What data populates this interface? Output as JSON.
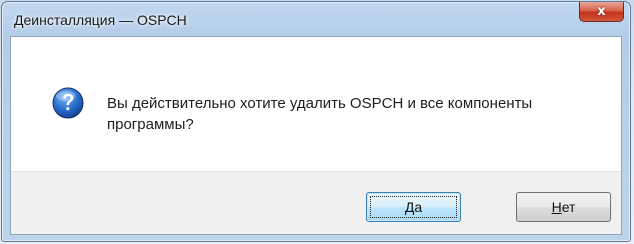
{
  "dialog": {
    "title": "Деинсталляция — OSPCH",
    "close_glyph": "x",
    "icon": "question-icon",
    "message": "Вы действительно хотите удалить OSPCH и все компоненты программы?",
    "buttons": {
      "yes": {
        "mnemonic": "Д",
        "rest": "а"
      },
      "no": {
        "mnemonic": "Н",
        "rest": "ет"
      }
    }
  },
  "colors": {
    "titlebar": "#b4cde8",
    "close": "#c2331b",
    "icon_blue": "#1a5fb4",
    "footer": "#f0f0f0"
  }
}
